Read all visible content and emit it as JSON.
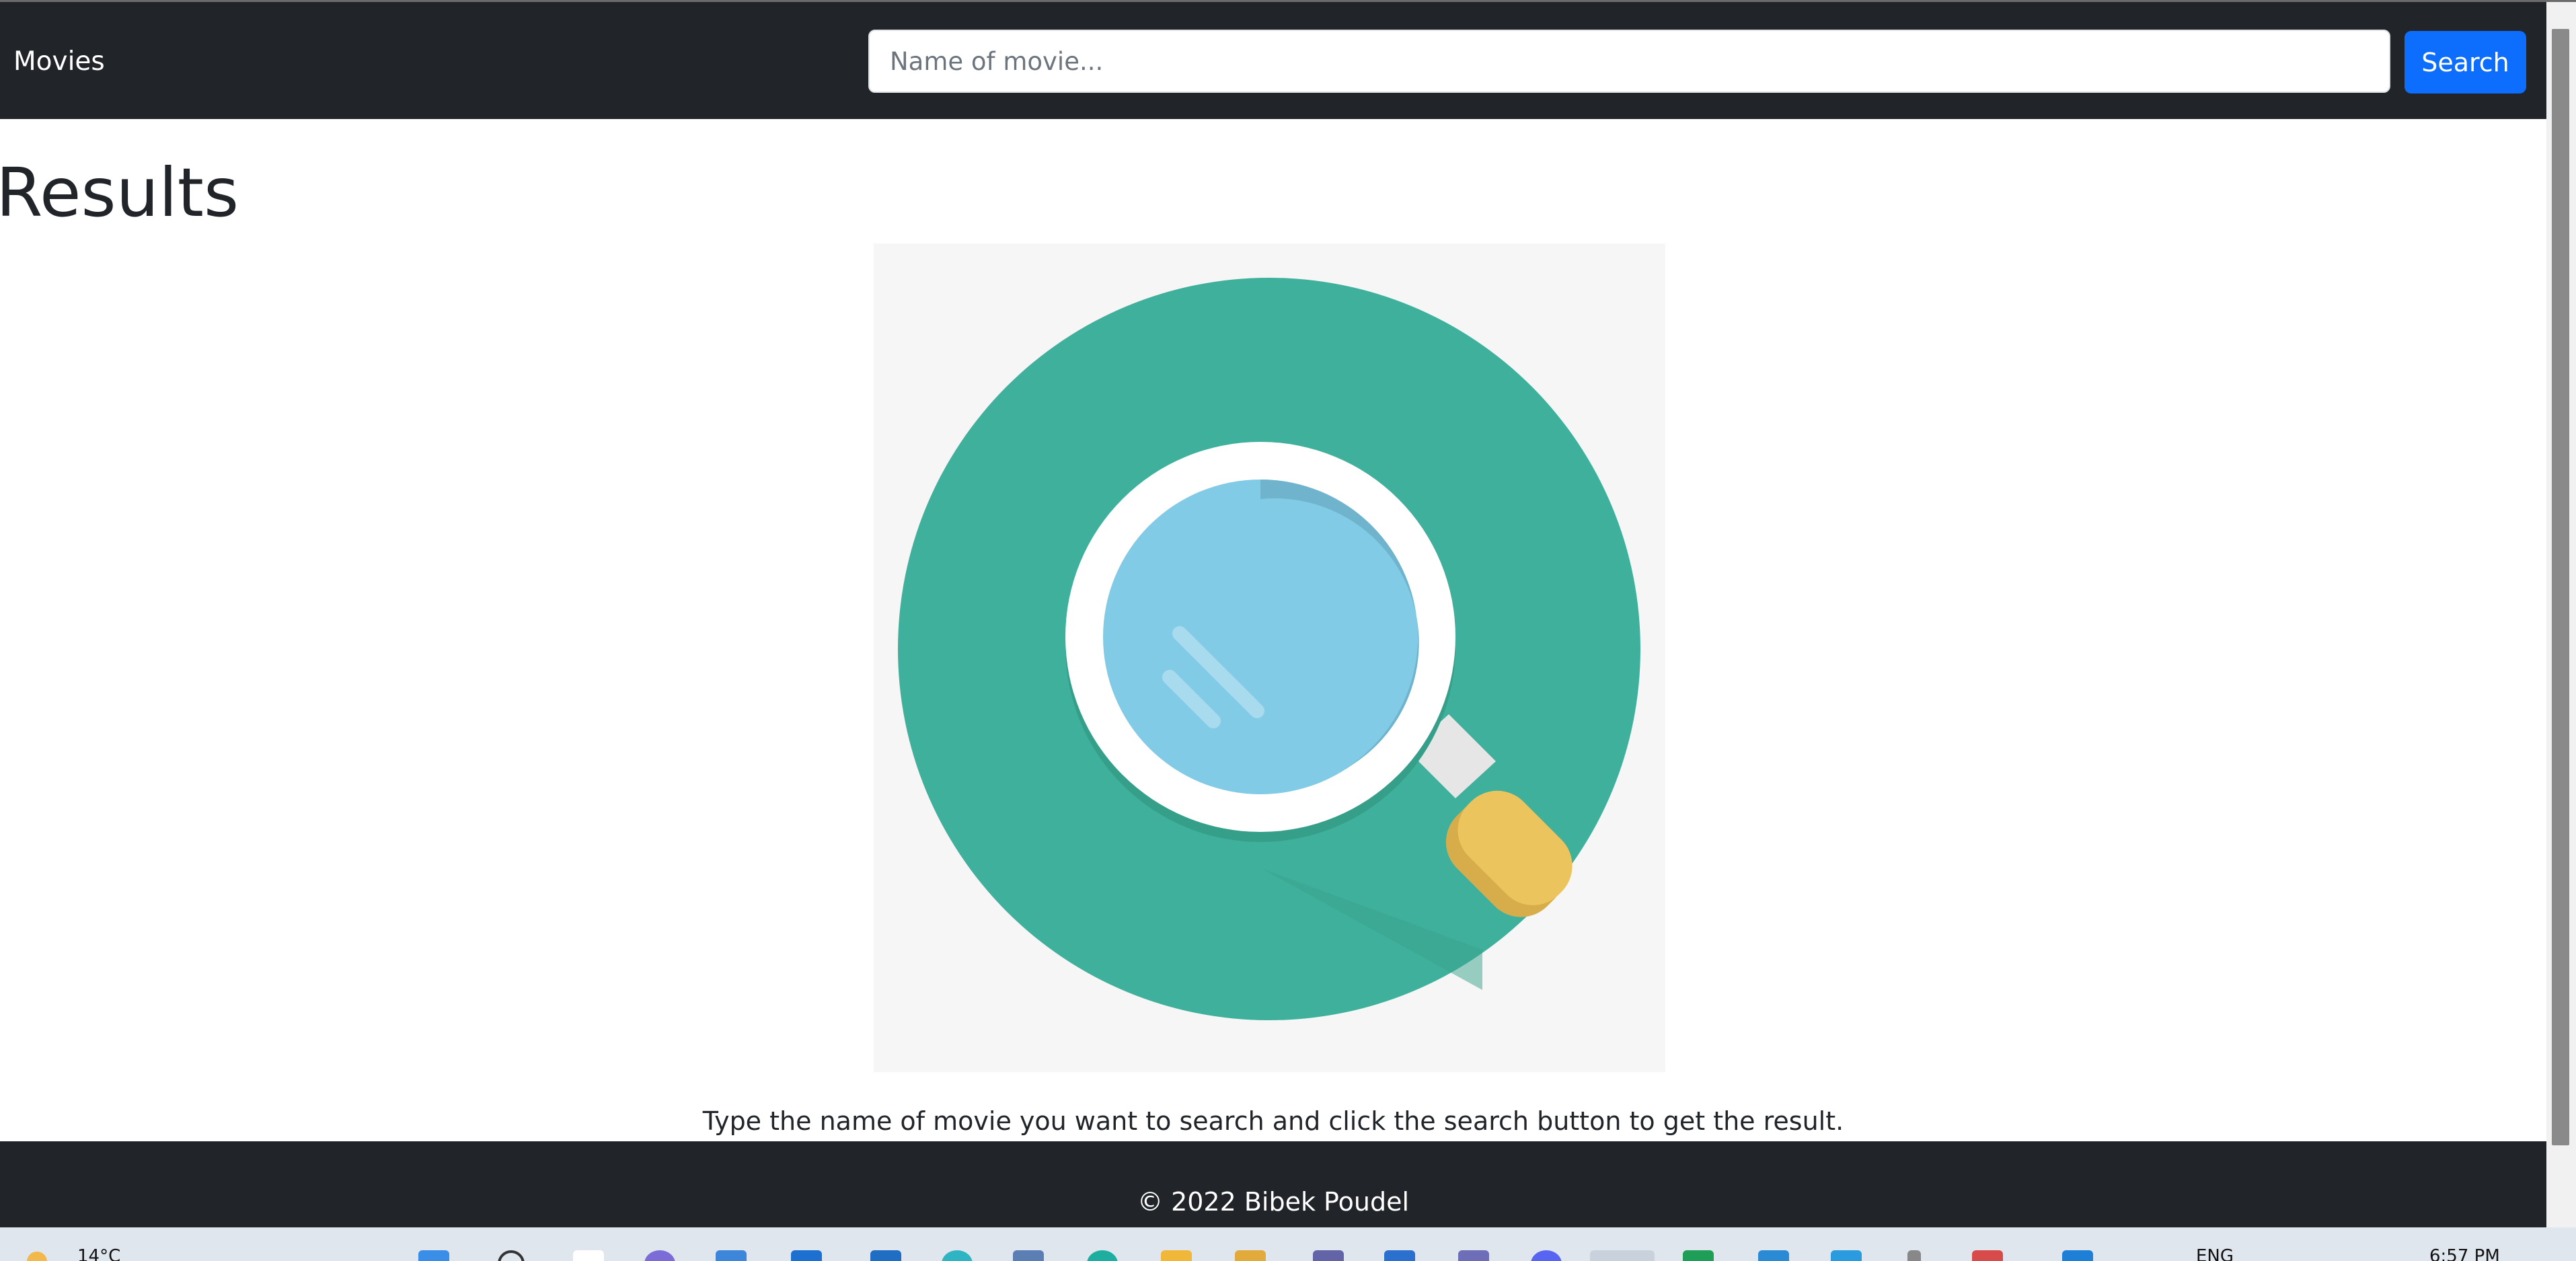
{
  "navbar": {
    "brand": "Movies",
    "search_placeholder": "Name of movie...",
    "search_value": "",
    "search_button": "Search"
  },
  "main": {
    "heading": "Results",
    "illustration_icon": "magnifying-glass-icon",
    "helper_text": "Type the name of movie you want to search and click the search button to get the result."
  },
  "footer": {
    "text": "© 2022 Bibek Poudel"
  },
  "taskbar": {
    "weather": "14°C",
    "language": "ENG",
    "time": "6:57 PM"
  },
  "colors": {
    "navbar_bg": "#212529",
    "primary_button": "#0d6efd",
    "illustration_teal": "#3fb09b",
    "illustration_lens": "#82cbe6",
    "illustration_handle": "#ecc45d"
  }
}
